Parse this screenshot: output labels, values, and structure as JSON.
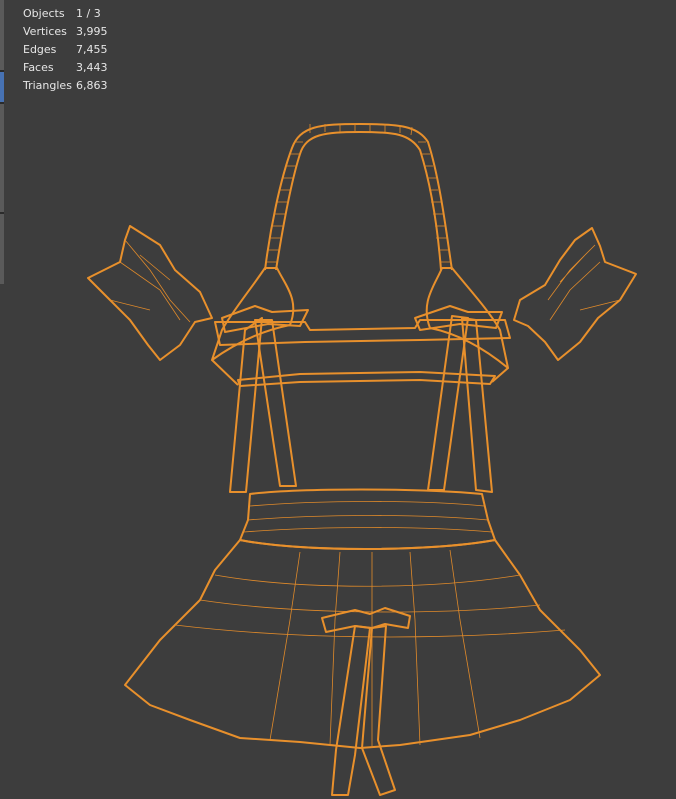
{
  "stats": {
    "objects": {
      "label": "Objects",
      "value": "1 / 3"
    },
    "vertices": {
      "label": "Vertices",
      "value": "3,995"
    },
    "edges": {
      "label": "Edges",
      "value": "7,455"
    },
    "faces": {
      "label": "Faces",
      "value": "3,443"
    },
    "triangles": {
      "label": "Triangles",
      "value": "6,863"
    }
  },
  "colors": {
    "background": "#3d3d3d",
    "wireframe": "#f0a044",
    "text": "#e6e6e6",
    "active_tab": "#4772b3"
  },
  "icons": [
    "toolbar-tab-icon"
  ]
}
